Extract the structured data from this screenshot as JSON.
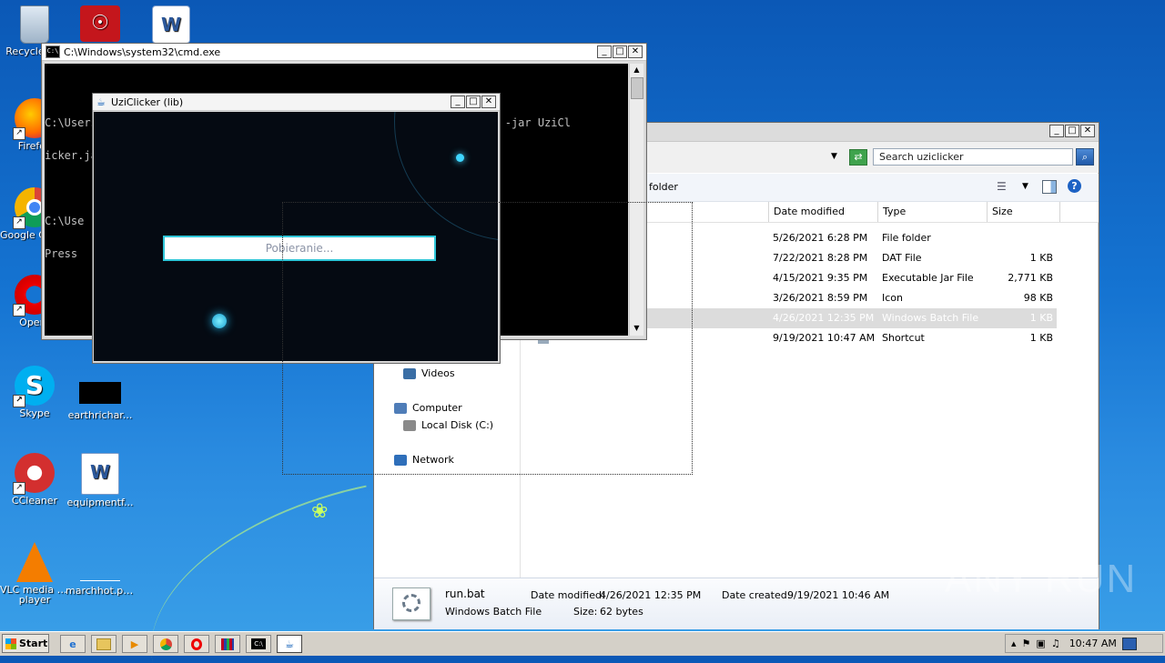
{
  "desktop": {
    "icons": [
      {
        "label": "Recycle Bin",
        "icon": "recycle-bin-icon"
      },
      {
        "label": "Firefox",
        "icon": "firefox-icon"
      },
      {
        "label": "Google Chrome",
        "icon": "chrome-icon"
      },
      {
        "label": "Opera",
        "icon": "opera-icon"
      },
      {
        "label": "Skype",
        "icon": "skype-icon"
      },
      {
        "label": "CCleaner",
        "icon": "ccleaner-icon"
      },
      {
        "label": "VLC media player",
        "icon": "vlc-icon"
      },
      {
        "label": "earthrichar...",
        "icon": "image-file-icon"
      },
      {
        "label": "equipmentf...",
        "icon": "word-doc-icon"
      },
      {
        "label": "marchhot.png",
        "icon": "image-file-icon"
      }
    ]
  },
  "cmd": {
    "title": "C:\\Windows\\system32\\cmd.exe",
    "line1": "C:\\Users\\admin\\Desktop\\uziclicker>java -noverify -javaagent:crack.jar -jar UziCl",
    "line2": "icker.jar",
    "line3": "C:\\Use",
    "line4": "Press "
  },
  "uzi": {
    "title": "UziClicker (lib)",
    "loading_text": "Pobieranie..."
  },
  "explorer": {
    "search_placeholder": "Search uziclicker",
    "toolbar_folder_label": "folder",
    "columns": [
      "Date modified",
      "Type",
      "Size"
    ],
    "rows": [
      {
        "date": "5/26/2021 6:28 PM",
        "type": "File folder",
        "size": ""
      },
      {
        "date": "7/22/2021 8:28 PM",
        "type": "DAT File",
        "size": "1 KB"
      },
      {
        "date": "4/15/2021 9:35 PM",
        "type": "Executable Jar File",
        "size": "2,771 KB"
      },
      {
        "date": "3/26/2021 8:59 PM",
        "type": "Icon",
        "size": "98 KB"
      },
      {
        "date": "4/26/2021 12:35 PM",
        "type": "Windows Batch File",
        "size": "1 KB"
      },
      {
        "date": "9/19/2021 10:47 AM",
        "type": "Shortcut",
        "size": "1 KB"
      }
    ],
    "nav": {
      "videos": "Videos",
      "computer": "Computer",
      "local_disk": "Local Disk (C:)",
      "network": "Network"
    },
    "details": {
      "name": "run.bat",
      "type": "Windows Batch File",
      "date_modified_label": "Date modified:",
      "date_modified": "4/26/2021 12:35 PM",
      "date_created_label": "Date created:",
      "date_created": "9/19/2021 10:46 AM",
      "size_label": "Size:",
      "size": "62 bytes"
    }
  },
  "taskbar": {
    "start_label": "Start",
    "clock": "10:47 AM"
  },
  "watermark": "ANY RUN"
}
